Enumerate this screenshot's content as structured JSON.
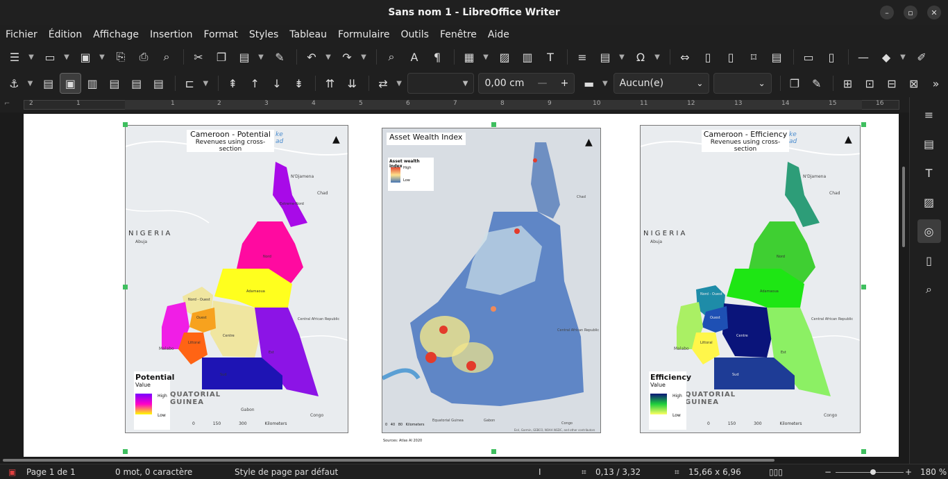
{
  "window": {
    "title": "Sans nom 1 - LibreOffice Writer"
  },
  "menu": [
    "Fichier",
    "Édition",
    "Affichage",
    "Insertion",
    "Format",
    "Styles",
    "Tableau",
    "Formulaire",
    "Outils",
    "Fenêtre",
    "Aide"
  ],
  "toolbar2": {
    "spacing_value": "0,00 cm",
    "wrap_value": "Aucun(e)"
  },
  "ruler_numbers": [
    "2",
    "1",
    "1",
    "2",
    "3",
    "4",
    "5",
    "6",
    "7",
    "8",
    "9",
    "10",
    "11",
    "12",
    "13",
    "14",
    "15",
    "16"
  ],
  "maps": {
    "potential": {
      "title": "Cameroon - Potential",
      "subtitle": "Revenues using cross-section",
      "legend_title": "Potential",
      "legend_value": "Value",
      "legend_high": "High",
      "legend_low": "Low",
      "nigeria": "N I G E R I A",
      "guinea": "QUATORIAL GUINEA",
      "scale": "0 150 300 Kilometers",
      "regions": [
        "Nord - Ouest",
        "Ouest",
        "Centre",
        "Littoral",
        "Adamaoua",
        "Est",
        "Sud",
        "Nord",
        "Extreme-Nord"
      ],
      "cities": [
        "N'Djamena",
        "Chad",
        "Abuja",
        "Central African Republic",
        "Malabo",
        "Congo",
        "Gabon"
      ]
    },
    "wealth": {
      "title": "Asset Wealth Index",
      "legend_title": "Asset wealth index",
      "legend_high": "High",
      "legend_low": "Low",
      "scale": "0 40 80 Kilometers",
      "source": "Sources: Atlas AI 2020",
      "credits": "Esri, Garmin, GEBCO, NOAA NGDC, and other contributors",
      "places": [
        "Chad",
        "Central African Republic",
        "Equatorial Guinea",
        "Gabon",
        "Congo"
      ]
    },
    "efficiency": {
      "title": "Cameroon - Efficiency",
      "subtitle": "Revenues using cross-section",
      "legend_title": "Efficiency",
      "legend_value": "Value",
      "legend_high": "High",
      "legend_low": "Low",
      "nigeria": "N I G E R I A",
      "guinea": "QUATORIAL GUINEA",
      "scale": "0 150 300 Kilometers",
      "regions": [
        "Nord - Ouest",
        "Ouest",
        "Centre",
        "Littoral",
        "Adamaoua",
        "Est",
        "Sud",
        "Nord"
      ],
      "cities": [
        "N'Djamena",
        "Chad",
        "Abuja",
        "Central African Republic",
        "Malabo",
        "Congo"
      ]
    }
  },
  "status": {
    "page": "Page 1 de 1",
    "words": "0 mot, 0 caractère",
    "page_style": "Style de page par défaut",
    "position": "0,13 / 3,32",
    "size": "15,66 x 6,96",
    "zoom": "180 %"
  },
  "colors": {
    "selection_handle": "#3fbf5f",
    "background": "#1f1f1f"
  }
}
